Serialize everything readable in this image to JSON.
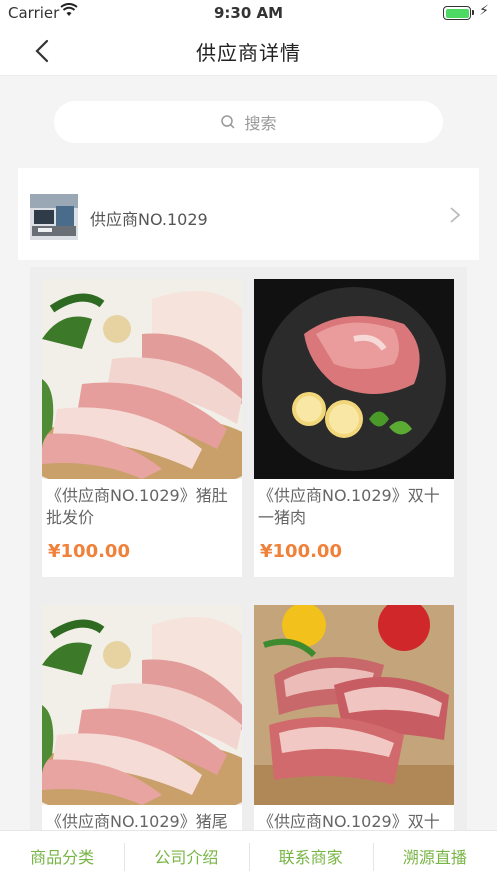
{
  "status": {
    "carrier": "Carrier",
    "time": "9:30 AM"
  },
  "nav": {
    "title": "供应商详情"
  },
  "search": {
    "placeholder": "搜索"
  },
  "supplier": {
    "name": "供应商NO.1029"
  },
  "products": [
    {
      "title": "《供应商NO.1029》猪肚批发价",
      "price": "¥100.00",
      "image": "pork-slices"
    },
    {
      "title": "《供应商NO.1029》双十一猪肉",
      "price": "¥100.00",
      "image": "pork-plate"
    },
    {
      "title": "《供应商NO.1029》猪尾",
      "price": "",
      "image": "pork-slices"
    },
    {
      "title": "《供应商NO.1029》双十",
      "price": "",
      "image": "pork-ribs"
    }
  ],
  "tabs": [
    "商品分类",
    "公司介绍",
    "联系商家",
    "溯源直播"
  ],
  "colors": {
    "accent": "#77b545",
    "price": "#f0813a"
  }
}
